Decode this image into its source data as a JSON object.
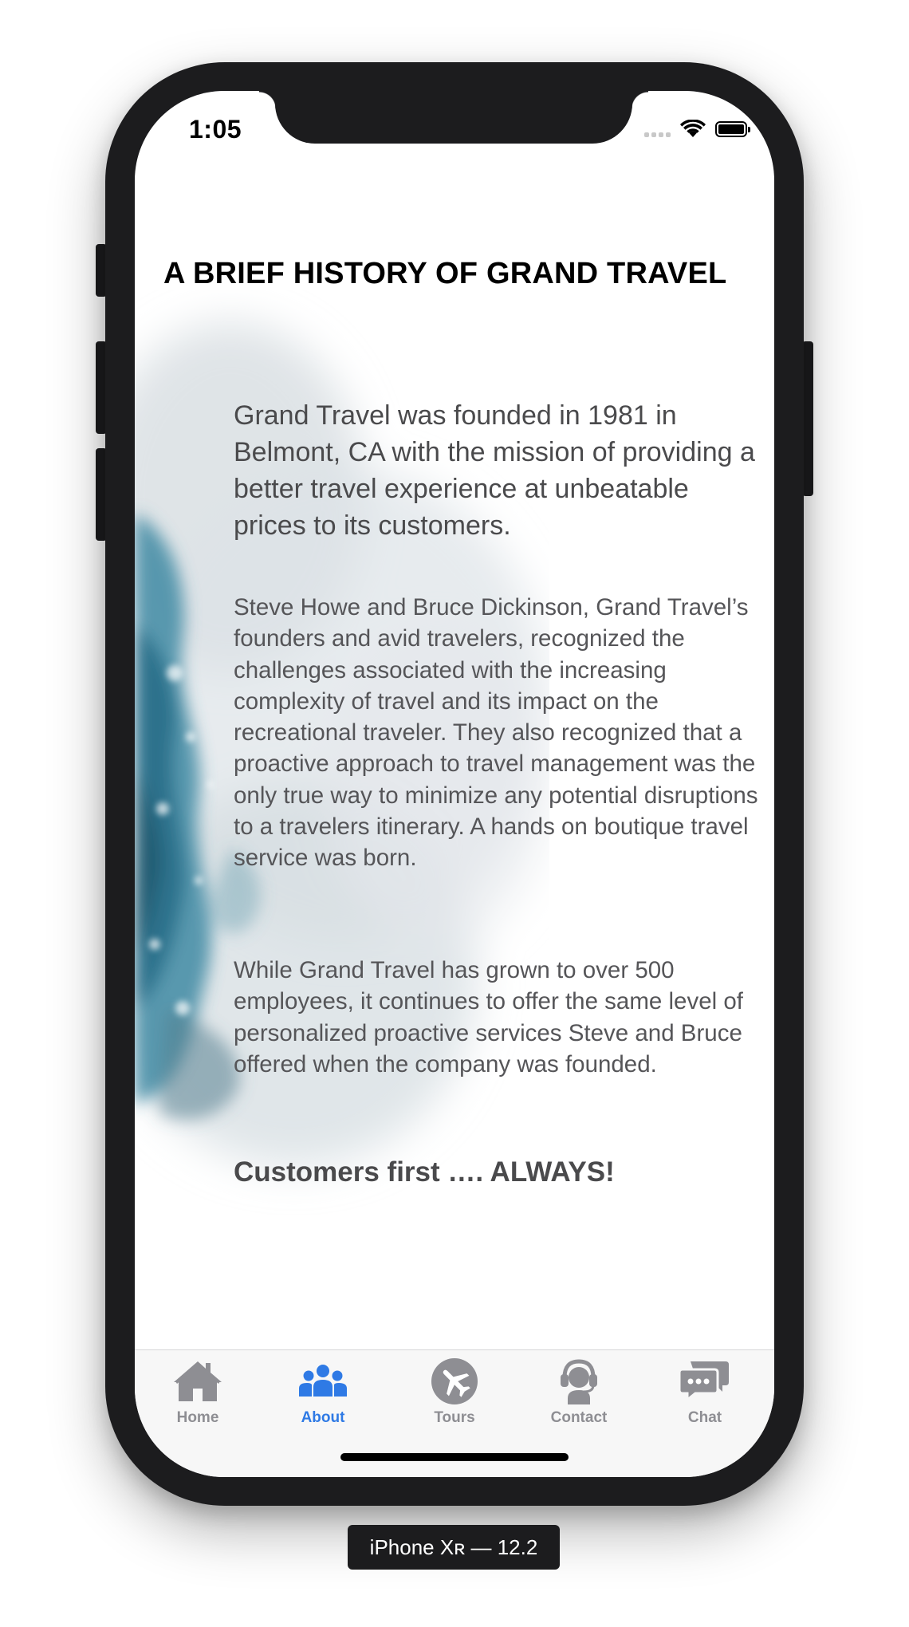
{
  "status_bar": {
    "time": "1:05"
  },
  "page": {
    "title": "A BRIEF HISTORY OF GRAND TRAVEL",
    "intro": "Grand Travel was founded in 1981 in Belmont, CA with the mission of providing a better travel experience at unbeatable prices to its customers.",
    "paragraphs": [
      "Steve Howe and Bruce Dickinson, Grand Travel’s founders and avid travelers, recognized the challenges associated with the increasing complexity of travel and its impact on the recreational traveler. They also recognized that a proactive approach to travel management was the only true way to minimize any potential disruptions to a travelers itinerary. A hands on boutique travel service was born.",
      "While Grand Travel has grown to over 500 employees, it continues to offer the same level of personalized proactive services Steve and Bruce offered when the company was founded."
    ],
    "tagline": "Customers first …. ALWAYS!"
  },
  "tab_bar": {
    "tabs": [
      {
        "label": "Home",
        "icon": "home-icon",
        "active": false
      },
      {
        "label": "About",
        "icon": "people-icon",
        "active": true
      },
      {
        "label": "Tours",
        "icon": "airplane-icon",
        "active": false
      },
      {
        "label": "Contact",
        "icon": "headset-icon",
        "active": false
      },
      {
        "label": "Chat",
        "icon": "chat-bubbles-icon",
        "active": false
      }
    ]
  },
  "device_label": "iPhone Xʀ — 12.2",
  "colors": {
    "tab_active": "#2f7ae5",
    "tab_inactive": "#8e8e93",
    "body_text": "#555558",
    "frame": "#1c1c1e",
    "splash_blue": "#2e7b94"
  }
}
